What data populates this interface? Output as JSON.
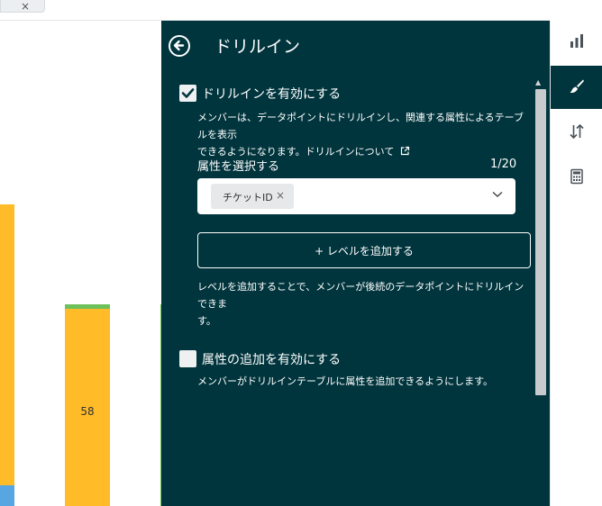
{
  "top_tab": {
    "close_glyph": "×"
  },
  "chart": {
    "bar_value_label": "58",
    "colors": {
      "main": "#ffbb28",
      "top": "#6ec05a",
      "bottom": "#57a6e2"
    }
  },
  "panel": {
    "title": "ドリルイン",
    "drillin_enable": {
      "label": "ドリルインを有効にする",
      "checked": true,
      "description_line1": "メンバーは、データポイントにドリルインし、関連する属性によるテーブルを表示",
      "description_line2": "できるようになります。ドリルインについて",
      "link_icon": "external-link-icon"
    },
    "attribute_select": {
      "label": "属性を選択する",
      "count": "1/20",
      "chip_label": "チケットID",
      "chip_remove": "×"
    },
    "add_level_button": "+ レベルを追加する",
    "add_level_description_line1": "レベルを追加することで、メンバーが後続のデータポイントにドリルインできま",
    "add_level_description_line2": "す。",
    "attribute_add_enable": {
      "label": "属性の追加を有効にする",
      "checked": false,
      "description": "メンバーがドリルインテーブルに属性を追加できるようにします。"
    },
    "colors": {
      "background": "#01353d",
      "text": "#ffffff"
    }
  },
  "sidebar": {
    "items": [
      {
        "icon": "bar-chart-icon",
        "active": false
      },
      {
        "icon": "paintbrush-icon",
        "active": true
      },
      {
        "icon": "sort-arrows-icon",
        "active": false
      },
      {
        "icon": "calculator-icon",
        "active": false
      }
    ]
  }
}
